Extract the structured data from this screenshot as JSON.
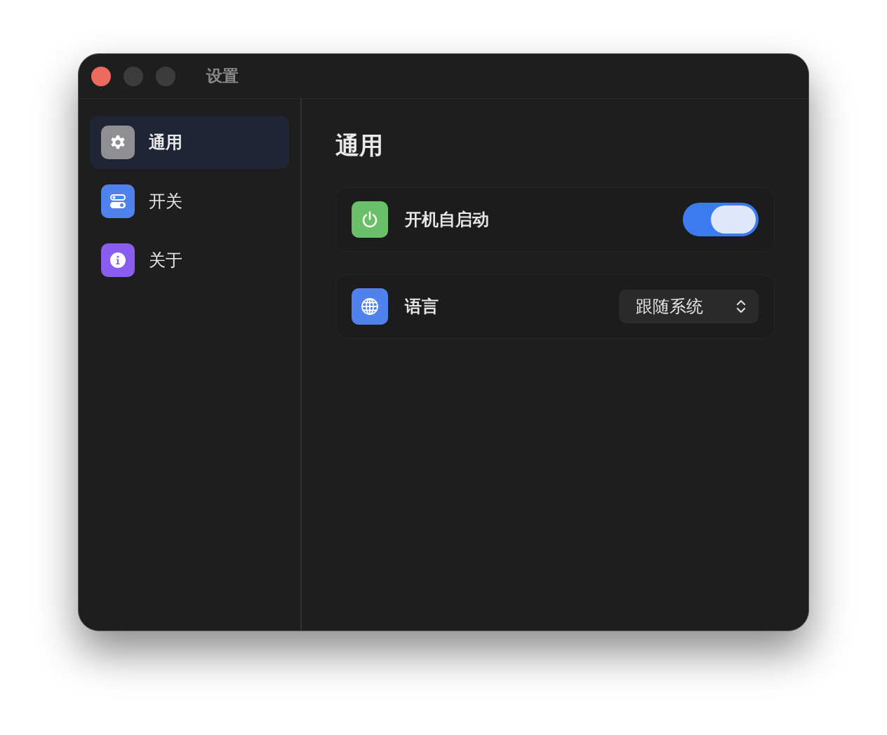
{
  "window": {
    "title": "设置"
  },
  "sidebar": {
    "items": [
      {
        "label": "通用",
        "color": "#8e8e93",
        "selected": true
      },
      {
        "label": "开关",
        "color": "#4f82ec",
        "selected": false
      },
      {
        "label": "关于",
        "color": "#8a5cf0",
        "selected": false
      }
    ]
  },
  "content": {
    "heading": "通用",
    "settings": [
      {
        "kind": "toggle",
        "color": "#6abf69",
        "label": "开机自启动",
        "on": true
      },
      {
        "kind": "select",
        "color": "#4f82ec",
        "label": "语言",
        "value": "跟随系统"
      }
    ]
  }
}
